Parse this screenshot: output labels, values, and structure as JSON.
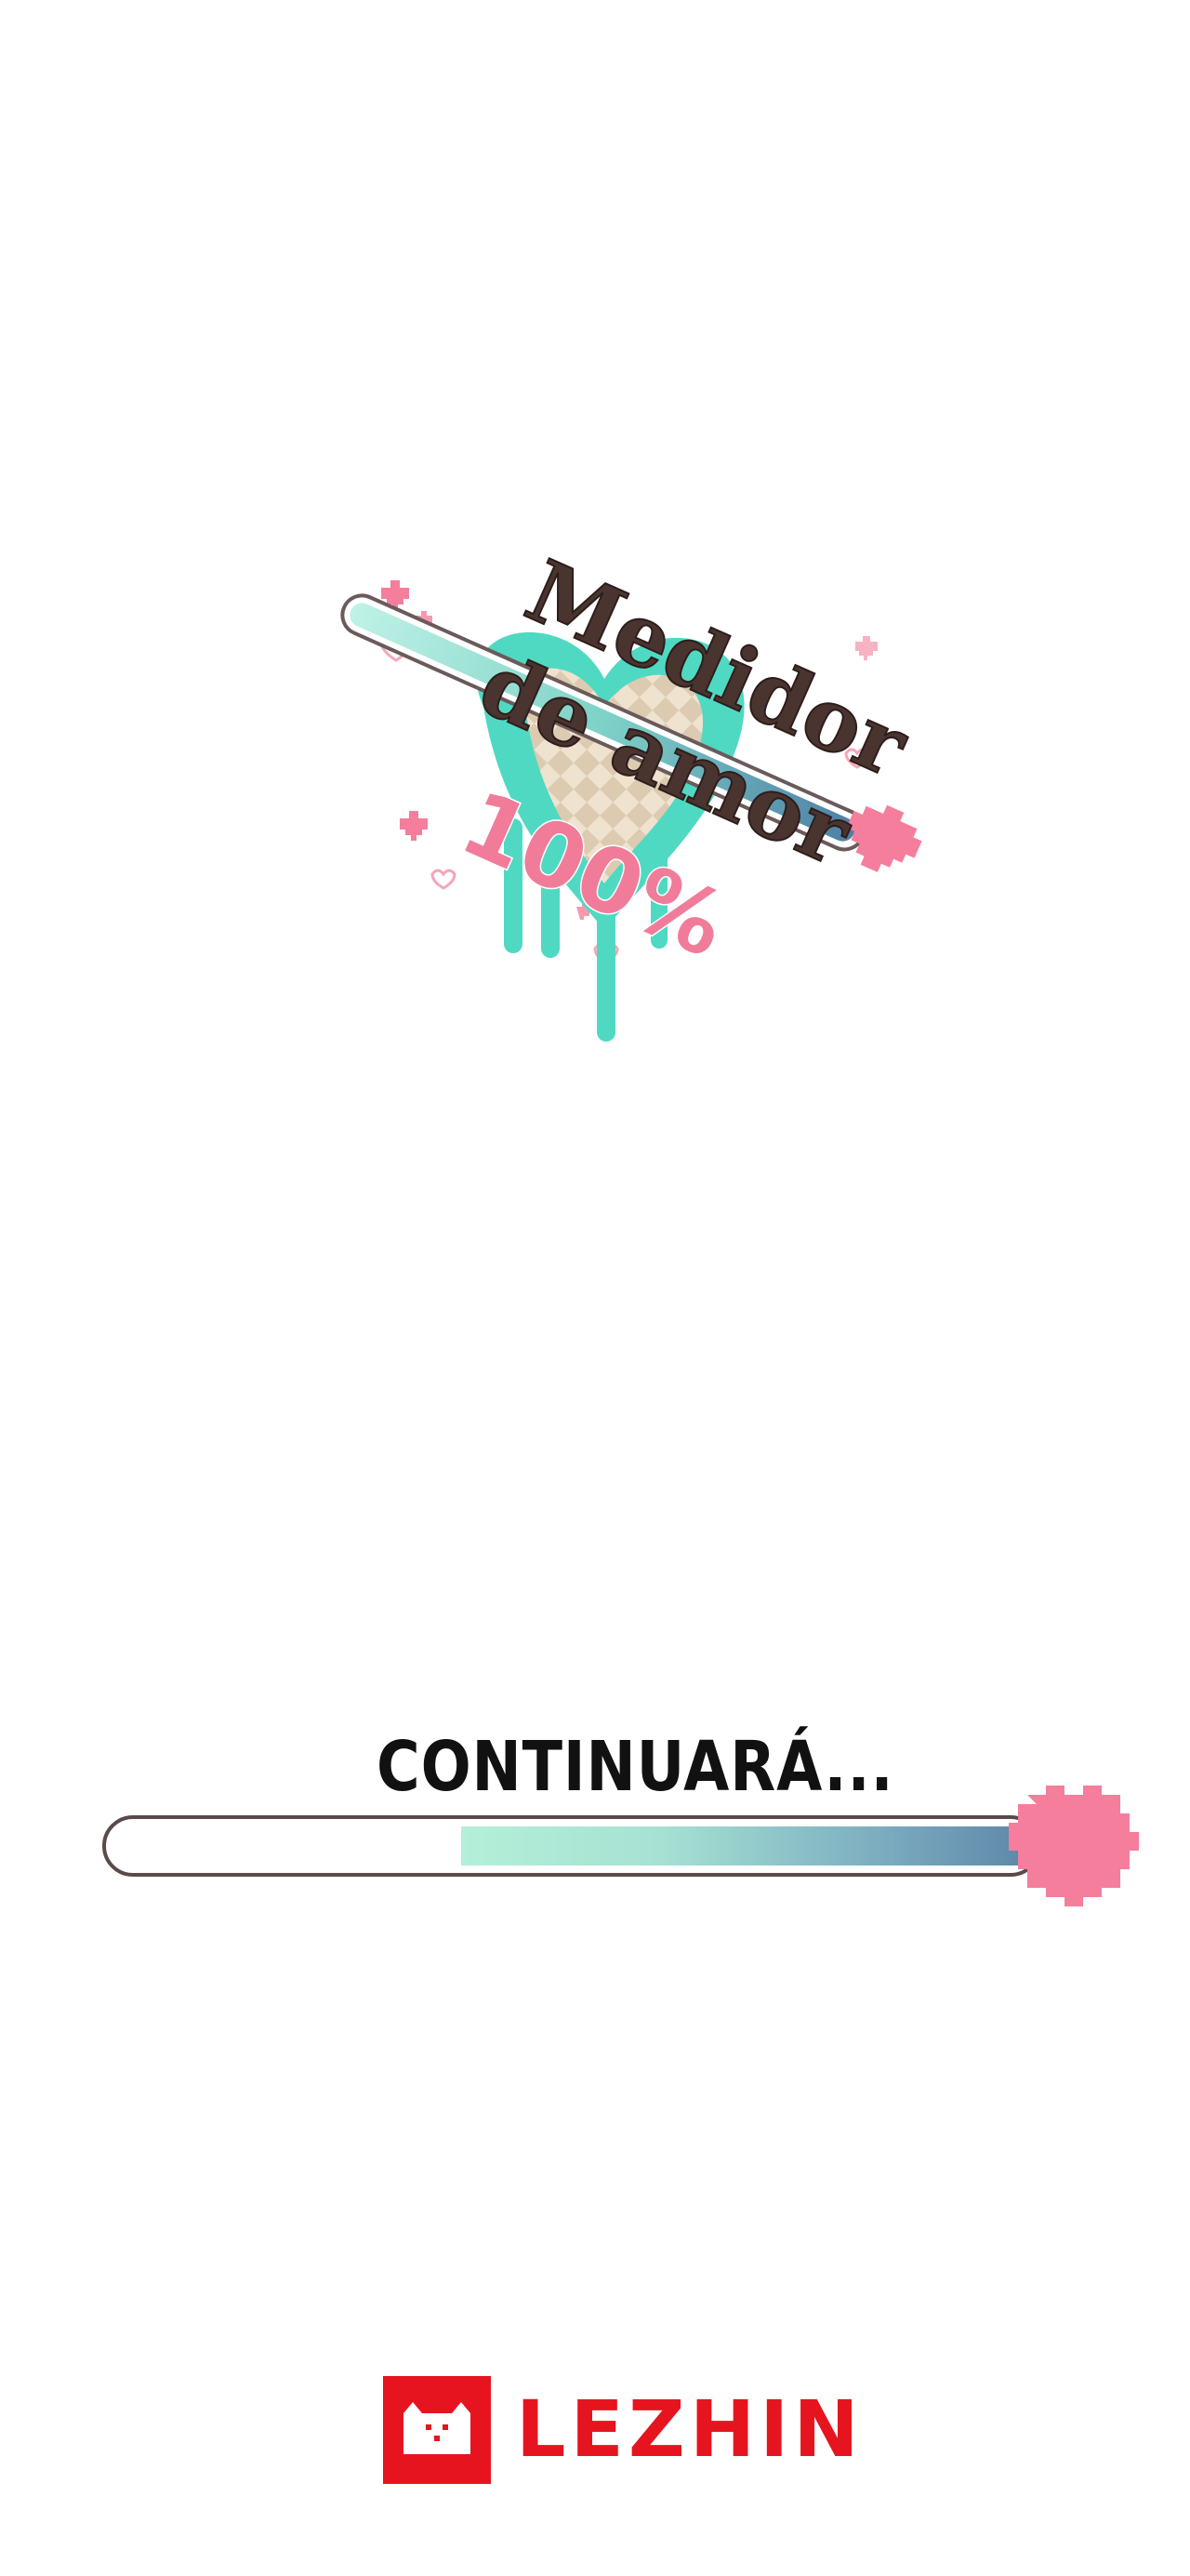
{
  "title_logo": {
    "line1": "Medidor",
    "line2": "de amor",
    "percent": "100%"
  },
  "ending": {
    "text": "CONTINUARÁ...",
    "progress": 0.62
  },
  "brand": {
    "name": "LEZHIN"
  },
  "colors": {
    "mint": "#4fd9c2",
    "pink": "#f47e9c",
    "brown": "#4a3430",
    "brand_red": "#e6141e"
  },
  "icons": [
    "pixel-heart-icon",
    "lezhin-cat-icon"
  ]
}
